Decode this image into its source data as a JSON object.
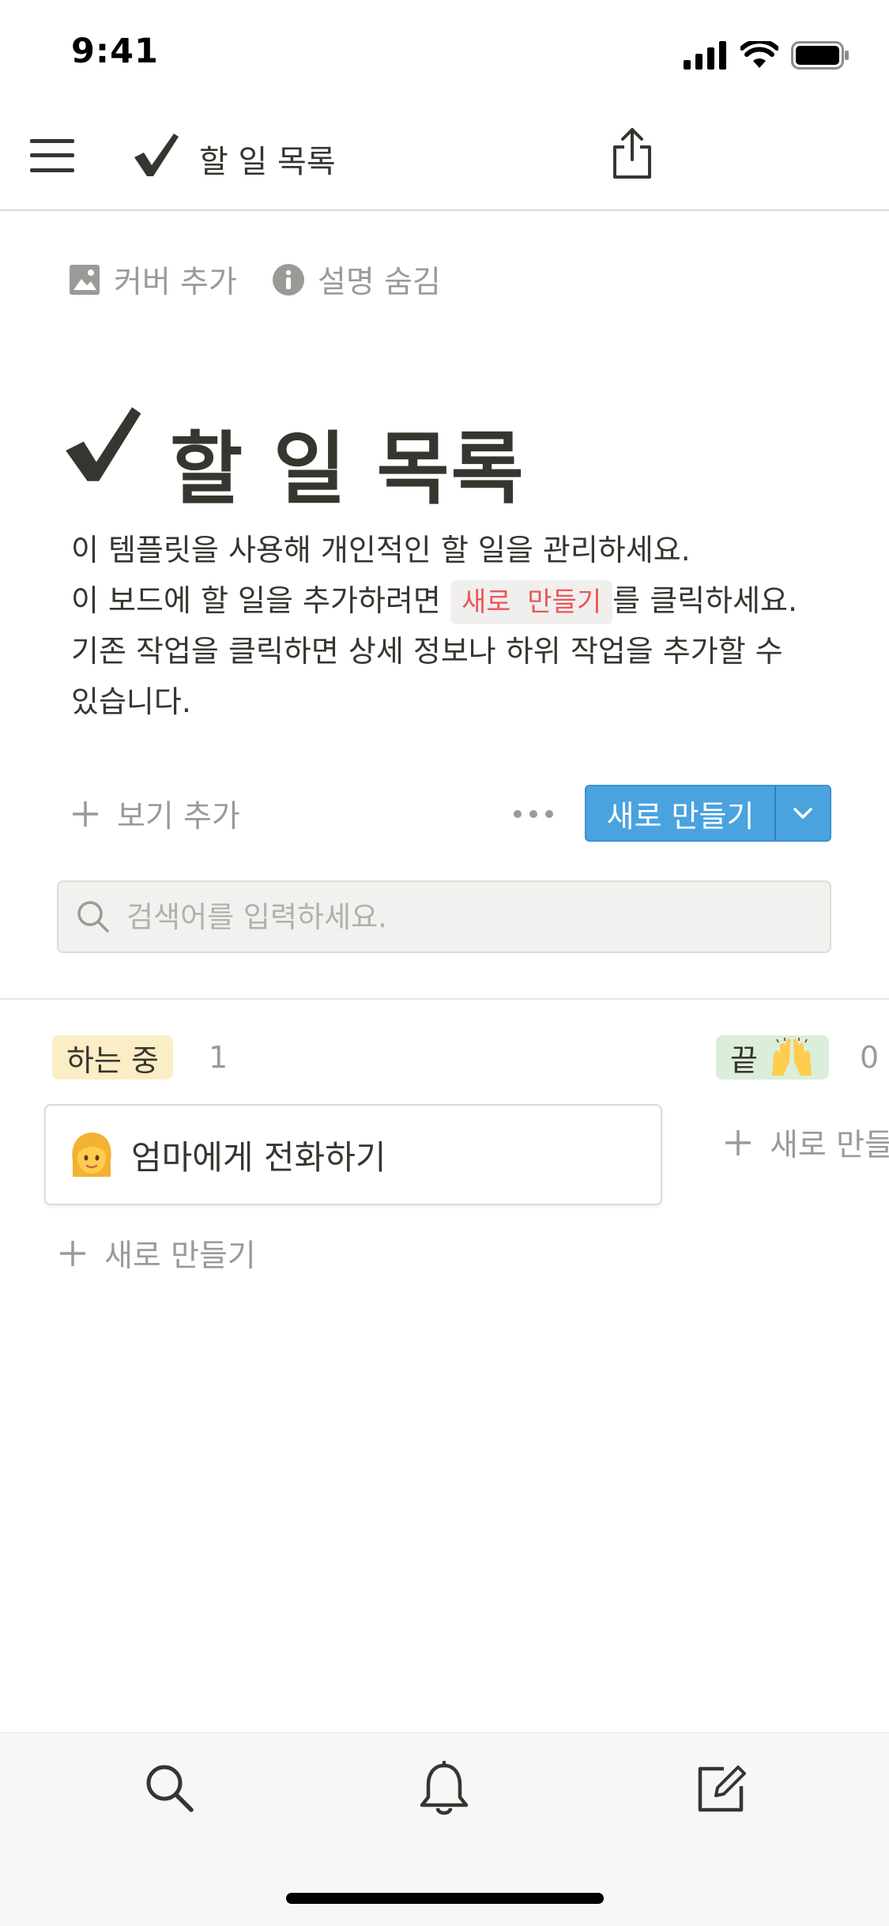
{
  "status_bar": {
    "time": "9:41",
    "icons": [
      "signal-icon",
      "wifi-icon",
      "battery-icon"
    ]
  },
  "nav": {
    "title": "할 일 목록",
    "icons": [
      "menu-icon",
      "checkmark-icon",
      "share-icon"
    ]
  },
  "page_actions": {
    "add_cover": "커버 추가",
    "hide_description": "설명 숨김"
  },
  "page": {
    "title": "할 일 목록",
    "description": {
      "line1": "이 템플릿을 사용해 개인적인 할 일을 관리하세요.",
      "line2_before": "이 보드에 할 일을 추가하려면",
      "line2_code": "새로 만들기",
      "line2_after": "를 클릭하세요.",
      "line3": "기존 작업을 클릭하면 상세 정보나 하위 작업을 추가할 수",
      "line4": "있습니다."
    }
  },
  "view_toolbar": {
    "add_view": "보기 추가",
    "new_button": "새로 만들기"
  },
  "search": {
    "placeholder": "검색어를 입력하세요."
  },
  "board": {
    "columns": [
      {
        "name": "하는 중",
        "count": "1",
        "color": "#fbedc5",
        "cards": [
          {
            "title": "엄마에게 전화하기",
            "emoji": "woman-emoji"
          }
        ],
        "new_label": "새로 만들기"
      },
      {
        "name": "끝",
        "emoji": "raising-hands-emoji",
        "count": "0",
        "color": "#dbeed9",
        "cards": [],
        "new_label": "새로 만들"
      }
    ]
  },
  "bottom_bar": {
    "icons": [
      "search-icon",
      "bell-icon",
      "compose-icon"
    ]
  },
  "colors": {
    "accent": "#4aa3df",
    "text": "#37352f",
    "muted": "#9b9a97",
    "code_red": "#eb5757"
  }
}
